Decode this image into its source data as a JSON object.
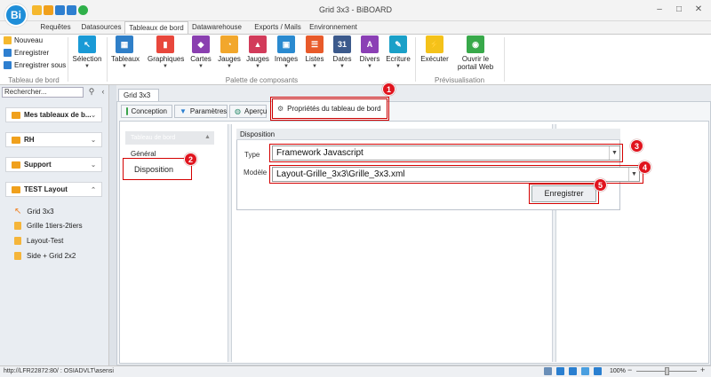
{
  "window": {
    "title": "Grid 3x3 - BiBOARD",
    "logo": "Bi"
  },
  "menu_tabs": [
    "Requêtes",
    "Datasources",
    "Tableaux de bord",
    "Datawarehouse",
    "Exports / Mails",
    "Environnement"
  ],
  "ribbon": {
    "file_group": {
      "items": [
        "Nouveau",
        "Enregistrer",
        "Enregistrer sous"
      ],
      "label": "Tableau de bord"
    },
    "selection": "Sélection",
    "components": [
      "Tableaux",
      "Graphiques",
      "Cartes",
      "Jauges",
      "Jauges",
      "Images",
      "Listes",
      "Dates",
      "Divers",
      "Ecriture"
    ],
    "components_label": "Palette de composants",
    "preview": [
      "Exécuter",
      "Ouvrir le portail Web"
    ],
    "preview_label": "Prévisualisation"
  },
  "left_panel": {
    "search_placeholder": "Rechercher...",
    "groups": [
      "Mes tableaux de b...",
      "RH",
      "Support",
      "TEST Layout"
    ],
    "items": [
      "Grid 3x3",
      "Grille 1tiers-2tiers",
      "Layout-Test",
      "Side + Grid 2x2"
    ]
  },
  "doc_tab": "Grid 3x3",
  "sub_tabs": [
    "Conception",
    "Paramètres",
    "Aperçu",
    "Propriétés du tableau de bord"
  ],
  "nav": {
    "header": "Tableau de bord",
    "general": "Général",
    "disposition": "Disposition"
  },
  "disposition": {
    "title": "Disposition",
    "type_label": "Type",
    "type_value": "Framework Javascript",
    "model_label": "Modèle",
    "model_value": "Layout-Grille_3x3\\Grille_3x3.xml",
    "save_button": "Enregistrer"
  },
  "badges": [
    "1",
    "2",
    "3",
    "4",
    "5"
  ],
  "status": {
    "text": "http://LFR22872:80/ : OSIADVLT\\asensi",
    "zoom": "100%"
  },
  "colors": {
    "accent": "#1f8ed8",
    "highlight": "#d40000",
    "folder": "#f0a01c"
  }
}
